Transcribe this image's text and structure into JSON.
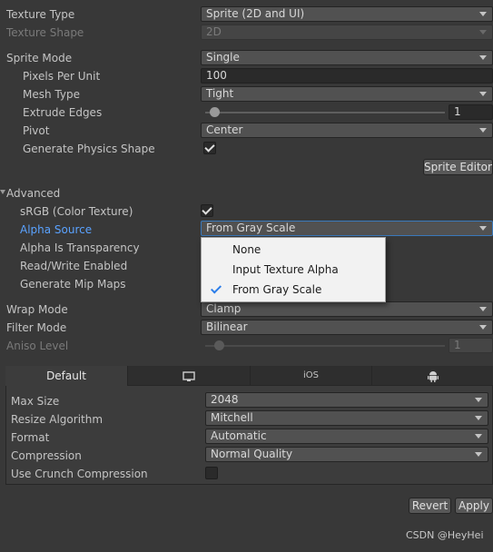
{
  "importer": {
    "texture_type": {
      "label": "Texture Type",
      "value": "Sprite (2D and UI)"
    },
    "texture_shape": {
      "label": "Texture Shape",
      "value": "2D"
    },
    "sprite_mode": {
      "label": "Sprite Mode",
      "value": "Single"
    },
    "pixels_per_unit": {
      "label": "Pixels Per Unit",
      "value": "100"
    },
    "mesh_type": {
      "label": "Mesh Type",
      "value": "Tight"
    },
    "extrude_edges": {
      "label": "Extrude Edges",
      "value": "1",
      "slider_fraction": 0.04
    },
    "pivot": {
      "label": "Pivot",
      "value": "Center"
    },
    "generate_physics_shape": {
      "label": "Generate Physics Shape",
      "checked": true
    },
    "sprite_editor_button": "Sprite Editor"
  },
  "advanced": {
    "header": "Advanced",
    "srgb": {
      "label": "sRGB (Color Texture)",
      "checked": true
    },
    "alpha_source": {
      "label": "Alpha Source",
      "value": "From Gray Scale"
    },
    "alpha_is_transparency": {
      "label": "Alpha Is Transparency"
    },
    "read_write": {
      "label": "Read/Write Enabled"
    },
    "mip_maps": {
      "label": "Generate Mip Maps"
    },
    "wrap_mode": {
      "label": "Wrap Mode",
      "value": "Clamp"
    },
    "filter_mode": {
      "label": "Filter Mode",
      "value": "Bilinear"
    },
    "aniso_level": {
      "label": "Aniso Level",
      "value": "1",
      "slider_fraction": 0.0
    }
  },
  "dropdown": {
    "options": [
      "None",
      "Input Texture Alpha",
      "From Gray Scale"
    ],
    "selected_index": 2,
    "check_color": "#2b7de9"
  },
  "platforms": {
    "tabs": [
      {
        "label": "Default",
        "icon": null
      },
      {
        "label": "",
        "icon": "monitor-icon"
      },
      {
        "label": "iOS",
        "icon": null
      },
      {
        "label": "",
        "icon": "android-icon"
      }
    ],
    "max_size": {
      "label": "Max Size",
      "value": "2048"
    },
    "resize_algorithm": {
      "label": "Resize Algorithm",
      "value": "Mitchell"
    },
    "format": {
      "label": "Format",
      "value": "Automatic"
    },
    "compression": {
      "label": "Compression",
      "value": "Normal Quality"
    },
    "crunch": {
      "label": "Use Crunch Compression",
      "checked": false
    }
  },
  "footer": {
    "revert": "Revert",
    "apply": "Apply",
    "watermark": "CSDN @HeyHei"
  },
  "colors": {
    "background": "#383838",
    "label_highlight": "#5aa2ff",
    "field_focus": "#3a79bb"
  }
}
